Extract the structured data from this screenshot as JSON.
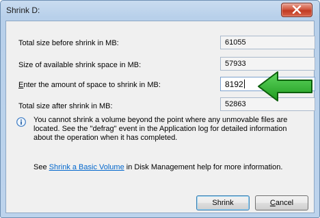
{
  "window": {
    "title": "Shrink D:"
  },
  "fields": [
    {
      "label": "Total size before shrink in MB:",
      "value": "61055"
    },
    {
      "label": "Size of available shrink space in MB:",
      "value": "57933"
    },
    {
      "label": "Enter the amount of space to shrink in MB:",
      "value": "8192"
    },
    {
      "label": "Total size after shrink in MB:",
      "value": "52863"
    }
  ],
  "info": {
    "icon": "info-icon",
    "text": "You cannot shrink a volume beyond the point where any unmovable files are located. See the \"defrag\" event in the Application log for detailed information about the operation when it has completed."
  },
  "help": {
    "prefix": "See ",
    "link": "Shrink a Basic Volume",
    "suffix": " in Disk Management help for more information."
  },
  "buttons": {
    "shrink": "Shrink",
    "cancel": "Cancel"
  },
  "colors": {
    "arrow_fill": "#2eb82e",
    "link": "#0066cc",
    "close": "#c13a22"
  }
}
